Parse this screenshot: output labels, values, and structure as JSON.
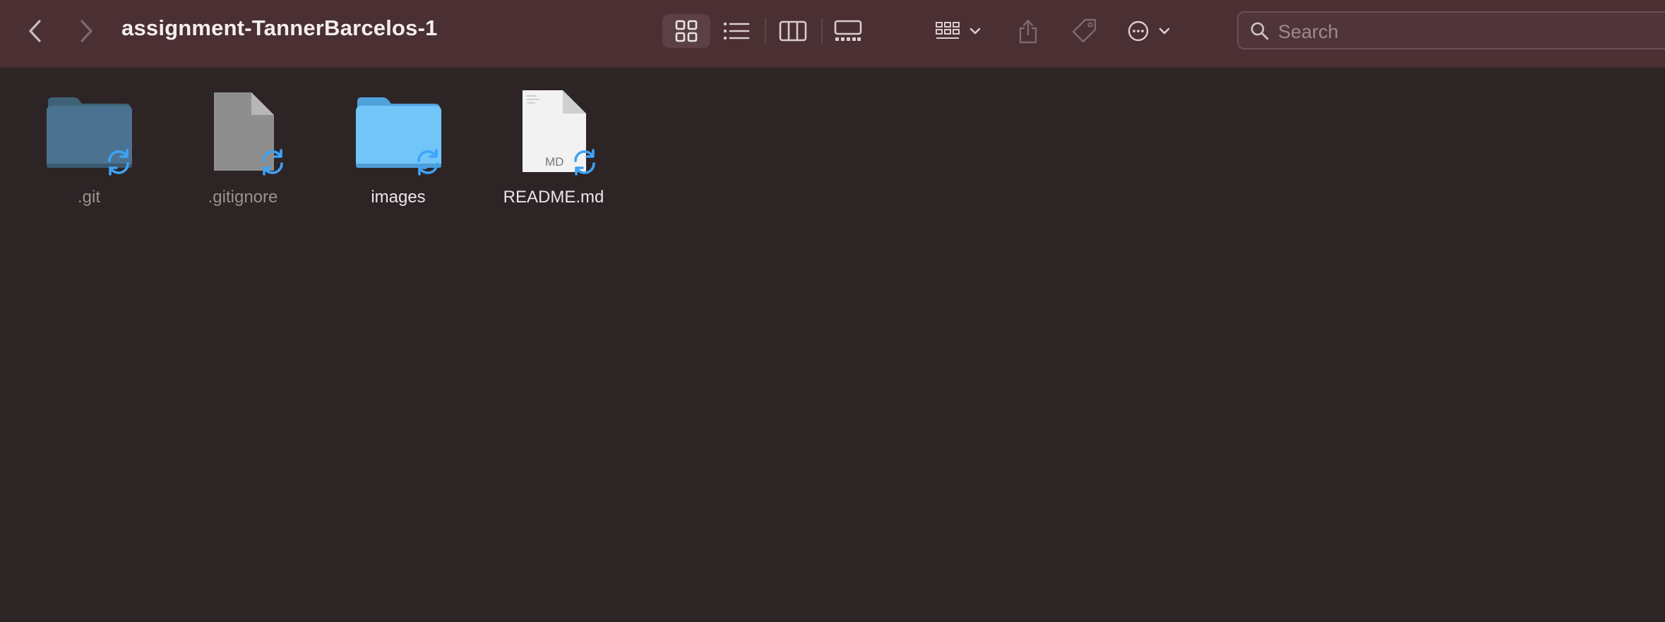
{
  "window": {
    "title": "assignment-TannerBarcelos-1"
  },
  "toolbar": {
    "back_icon": "chevron-left-icon",
    "forward_icon": "chevron-right-icon",
    "views": [
      {
        "name": "icon-view",
        "icon": "grid-icon",
        "selected": true
      },
      {
        "name": "list-view",
        "icon": "list-icon",
        "selected": false
      },
      {
        "name": "column-view",
        "icon": "columns-icon",
        "selected": false
      },
      {
        "name": "gallery-view",
        "icon": "gallery-icon",
        "selected": false
      }
    ],
    "group_icon": "group-icon",
    "share_icon": "share-icon",
    "tag_icon": "tag-icon",
    "more_icon": "ellipsis-circle-icon"
  },
  "search": {
    "placeholder": "Search"
  },
  "files": [
    {
      "name": ".git",
      "kind": "folder",
      "hidden": true
    },
    {
      "name": ".gitignore",
      "kind": "file",
      "hidden": true
    },
    {
      "name": "images",
      "kind": "folder",
      "hidden": false
    },
    {
      "name": "README.md",
      "kind": "markdown",
      "hidden": false,
      "badge": "MD"
    }
  ],
  "colors": {
    "toolbar_bg": "#4a2f33",
    "window_bg": "#2d2426",
    "sync_blue": "#3ea3f5",
    "folder_blue": "#6ec3f7"
  }
}
